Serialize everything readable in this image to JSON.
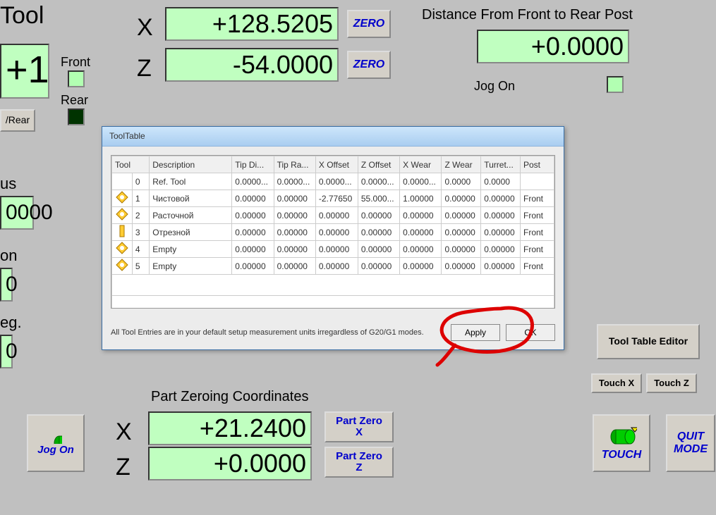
{
  "topleft_title": "Tool",
  "tool_number": "+1",
  "front_label": "Front",
  "rear_label": "Rear",
  "front_rear_btn": "/Rear",
  "axis_x": "X",
  "axis_z": "Z",
  "dro_x": "+128.5205",
  "dro_z": "-54.0000",
  "zero_btn": "ZERO",
  "dist_label": "Distance From Front to Rear Post",
  "dist_value": "+0.0000",
  "jog_on_label": "Jog On",
  "left_partial_us": "us",
  "left_partial_dro1": "0000",
  "left_partial_on": "on",
  "left_partial_dro2": "0",
  "left_partial_eg": "eg.",
  "left_partial_dro3": "0",
  "part_zero_title": "Part Zeroing Coordinates",
  "part_x": "+21.2400",
  "part_z": "+0.0000",
  "part_zero_x_btn": "Part Zero\nX",
  "part_zero_z_btn": "Part Zero\nZ",
  "jog_on_btn": "Jog On",
  "tool_table_editor_btn": "Tool Table Editor",
  "touch_x_btn": "Touch X",
  "touch_z_btn": "Touch Z",
  "touch_btn": "TOUCH",
  "quit_btn": "QUIT\nMODE",
  "dialog": {
    "title": "ToolTable",
    "headers": [
      "Tool",
      "Description",
      "Tip Di...",
      "Tip Ra...",
      "X Offset",
      "Z Offset",
      "X Wear",
      "Z Wear",
      "Turret...",
      "Post"
    ],
    "rows": [
      {
        "n": "0",
        "desc": "Ref. Tool",
        "tipd": "0.0000...",
        "tipr": "0.0000...",
        "xoff": "0.0000...",
        "zoff": "0.0000...",
        "xw": "0.0000...",
        "zw": "0.0000",
        "tur": "0.0000",
        "post": "",
        "icon": ""
      },
      {
        "n": "1",
        "desc": "Чистовой",
        "tipd": "0.00000",
        "tipr": "0.00000",
        "xoff": "-2.77650",
        "zoff": "55.000...",
        "xw": "1.00000",
        "zw": "0.00000",
        "tur": "0.00000",
        "post": "Front",
        "icon": "diamond"
      },
      {
        "n": "2",
        "desc": "Расточной",
        "tipd": "0.00000",
        "tipr": "0.00000",
        "xoff": "0.00000",
        "zoff": "0.00000",
        "xw": "0.00000",
        "zw": "0.00000",
        "tur": "0.00000",
        "post": "Front",
        "icon": "diamond"
      },
      {
        "n": "3",
        "desc": "Отрезной",
        "tipd": "0.00000",
        "tipr": "0.00000",
        "xoff": "0.00000",
        "zoff": "0.00000",
        "xw": "0.00000",
        "zw": "0.00000",
        "tur": "0.00000",
        "post": "Front",
        "icon": "bar"
      },
      {
        "n": "4",
        "desc": "Empty",
        "tipd": "0.00000",
        "tipr": "0.00000",
        "xoff": "0.00000",
        "zoff": "0.00000",
        "xw": "0.00000",
        "zw": "0.00000",
        "tur": "0.00000",
        "post": "Front",
        "icon": "diamond"
      },
      {
        "n": "5",
        "desc": "Empty",
        "tipd": "0.00000",
        "tipr": "0.00000",
        "xoff": "0.00000",
        "zoff": "0.00000",
        "xw": "0.00000",
        "zw": "0.00000",
        "tur": "0.00000",
        "post": "Front",
        "icon": "diamond"
      }
    ],
    "footer_note": "All Tool Entries are in your default setup measurement units irregardless of G20/G1 modes.",
    "apply": "Apply",
    "ok": "OK"
  }
}
